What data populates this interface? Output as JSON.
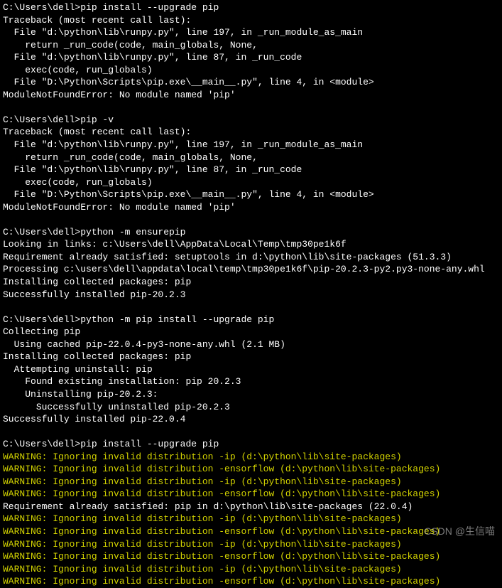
{
  "terminal": {
    "lines": [
      {
        "text": "C:\\Users\\dell>pip install --upgrade pip",
        "cls": "prompt"
      },
      {
        "text": "Traceback (most recent call last):",
        "cls": ""
      },
      {
        "text": "  File \"d:\\python\\lib\\runpy.py\", line 197, in _run_module_as_main",
        "cls": ""
      },
      {
        "text": "    return _run_code(code, main_globals, None,",
        "cls": ""
      },
      {
        "text": "  File \"d:\\python\\lib\\runpy.py\", line 87, in _run_code",
        "cls": ""
      },
      {
        "text": "    exec(code, run_globals)",
        "cls": ""
      },
      {
        "text": "  File \"D:\\Python\\Scripts\\pip.exe\\__main__.py\", line 4, in <module>",
        "cls": ""
      },
      {
        "text": "ModuleNotFoundError: No module named 'pip'",
        "cls": ""
      },
      {
        "text": "",
        "cls": ""
      },
      {
        "text": "C:\\Users\\dell>pip -v",
        "cls": "prompt"
      },
      {
        "text": "Traceback (most recent call last):",
        "cls": ""
      },
      {
        "text": "  File \"d:\\python\\lib\\runpy.py\", line 197, in _run_module_as_main",
        "cls": ""
      },
      {
        "text": "    return _run_code(code, main_globals, None,",
        "cls": ""
      },
      {
        "text": "  File \"d:\\python\\lib\\runpy.py\", line 87, in _run_code",
        "cls": ""
      },
      {
        "text": "    exec(code, run_globals)",
        "cls": ""
      },
      {
        "text": "  File \"D:\\Python\\Scripts\\pip.exe\\__main__.py\", line 4, in <module>",
        "cls": ""
      },
      {
        "text": "ModuleNotFoundError: No module named 'pip'",
        "cls": ""
      },
      {
        "text": "",
        "cls": ""
      },
      {
        "text": "C:\\Users\\dell>python -m ensurepip",
        "cls": "prompt"
      },
      {
        "text": "Looking in links: c:\\Users\\dell\\AppData\\Local\\Temp\\tmp30pe1k6f",
        "cls": ""
      },
      {
        "text": "Requirement already satisfied: setuptools in d:\\python\\lib\\site-packages (51.3.3)",
        "cls": ""
      },
      {
        "text": "Processing c:\\users\\dell\\appdata\\local\\temp\\tmp30pe1k6f\\pip-20.2.3-py2.py3-none-any.whl",
        "cls": ""
      },
      {
        "text": "Installing collected packages: pip",
        "cls": ""
      },
      {
        "text": "Successfully installed pip-20.2.3",
        "cls": ""
      },
      {
        "text": "",
        "cls": ""
      },
      {
        "text": "C:\\Users\\dell>python -m pip install --upgrade pip",
        "cls": "prompt"
      },
      {
        "text": "Collecting pip",
        "cls": ""
      },
      {
        "text": "  Using cached pip-22.0.4-py3-none-any.whl (2.1 MB)",
        "cls": ""
      },
      {
        "text": "Installing collected packages: pip",
        "cls": ""
      },
      {
        "text": "  Attempting uninstall: pip",
        "cls": ""
      },
      {
        "text": "    Found existing installation: pip 20.2.3",
        "cls": ""
      },
      {
        "text": "    Uninstalling pip-20.2.3:",
        "cls": ""
      },
      {
        "text": "      Successfully uninstalled pip-20.2.3",
        "cls": ""
      },
      {
        "text": "Successfully installed pip-22.0.4",
        "cls": ""
      },
      {
        "text": "",
        "cls": ""
      },
      {
        "text": "C:\\Users\\dell>pip install --upgrade pip",
        "cls": "prompt"
      },
      {
        "text": "WARNING: Ignoring invalid distribution -ip (d:\\python\\lib\\site-packages)",
        "cls": "warning"
      },
      {
        "text": "WARNING: Ignoring invalid distribution -ensorflow (d:\\python\\lib\\site-packages)",
        "cls": "warning"
      },
      {
        "text": "WARNING: Ignoring invalid distribution -ip (d:\\python\\lib\\site-packages)",
        "cls": "warning"
      },
      {
        "text": "WARNING: Ignoring invalid distribution -ensorflow (d:\\python\\lib\\site-packages)",
        "cls": "warning"
      },
      {
        "text": "Requirement already satisfied: pip in d:\\python\\lib\\site-packages (22.0.4)",
        "cls": ""
      },
      {
        "text": "WARNING: Ignoring invalid distribution -ip (d:\\python\\lib\\site-packages)",
        "cls": "warning"
      },
      {
        "text": "WARNING: Ignoring invalid distribution -ensorflow (d:\\python\\lib\\site-packages)",
        "cls": "warning"
      },
      {
        "text": "WARNING: Ignoring invalid distribution -ip (d:\\python\\lib\\site-packages)",
        "cls": "warning"
      },
      {
        "text": "WARNING: Ignoring invalid distribution -ensorflow (d:\\python\\lib\\site-packages)",
        "cls": "warning"
      },
      {
        "text": "WARNING: Ignoring invalid distribution -ip (d:\\python\\lib\\site-packages)",
        "cls": "warning"
      },
      {
        "text": "WARNING: Ignoring invalid distribution -ensorflow (d:\\python\\lib\\site-packages)",
        "cls": "warning"
      }
    ]
  },
  "watermark": "CSDN @生信喵"
}
